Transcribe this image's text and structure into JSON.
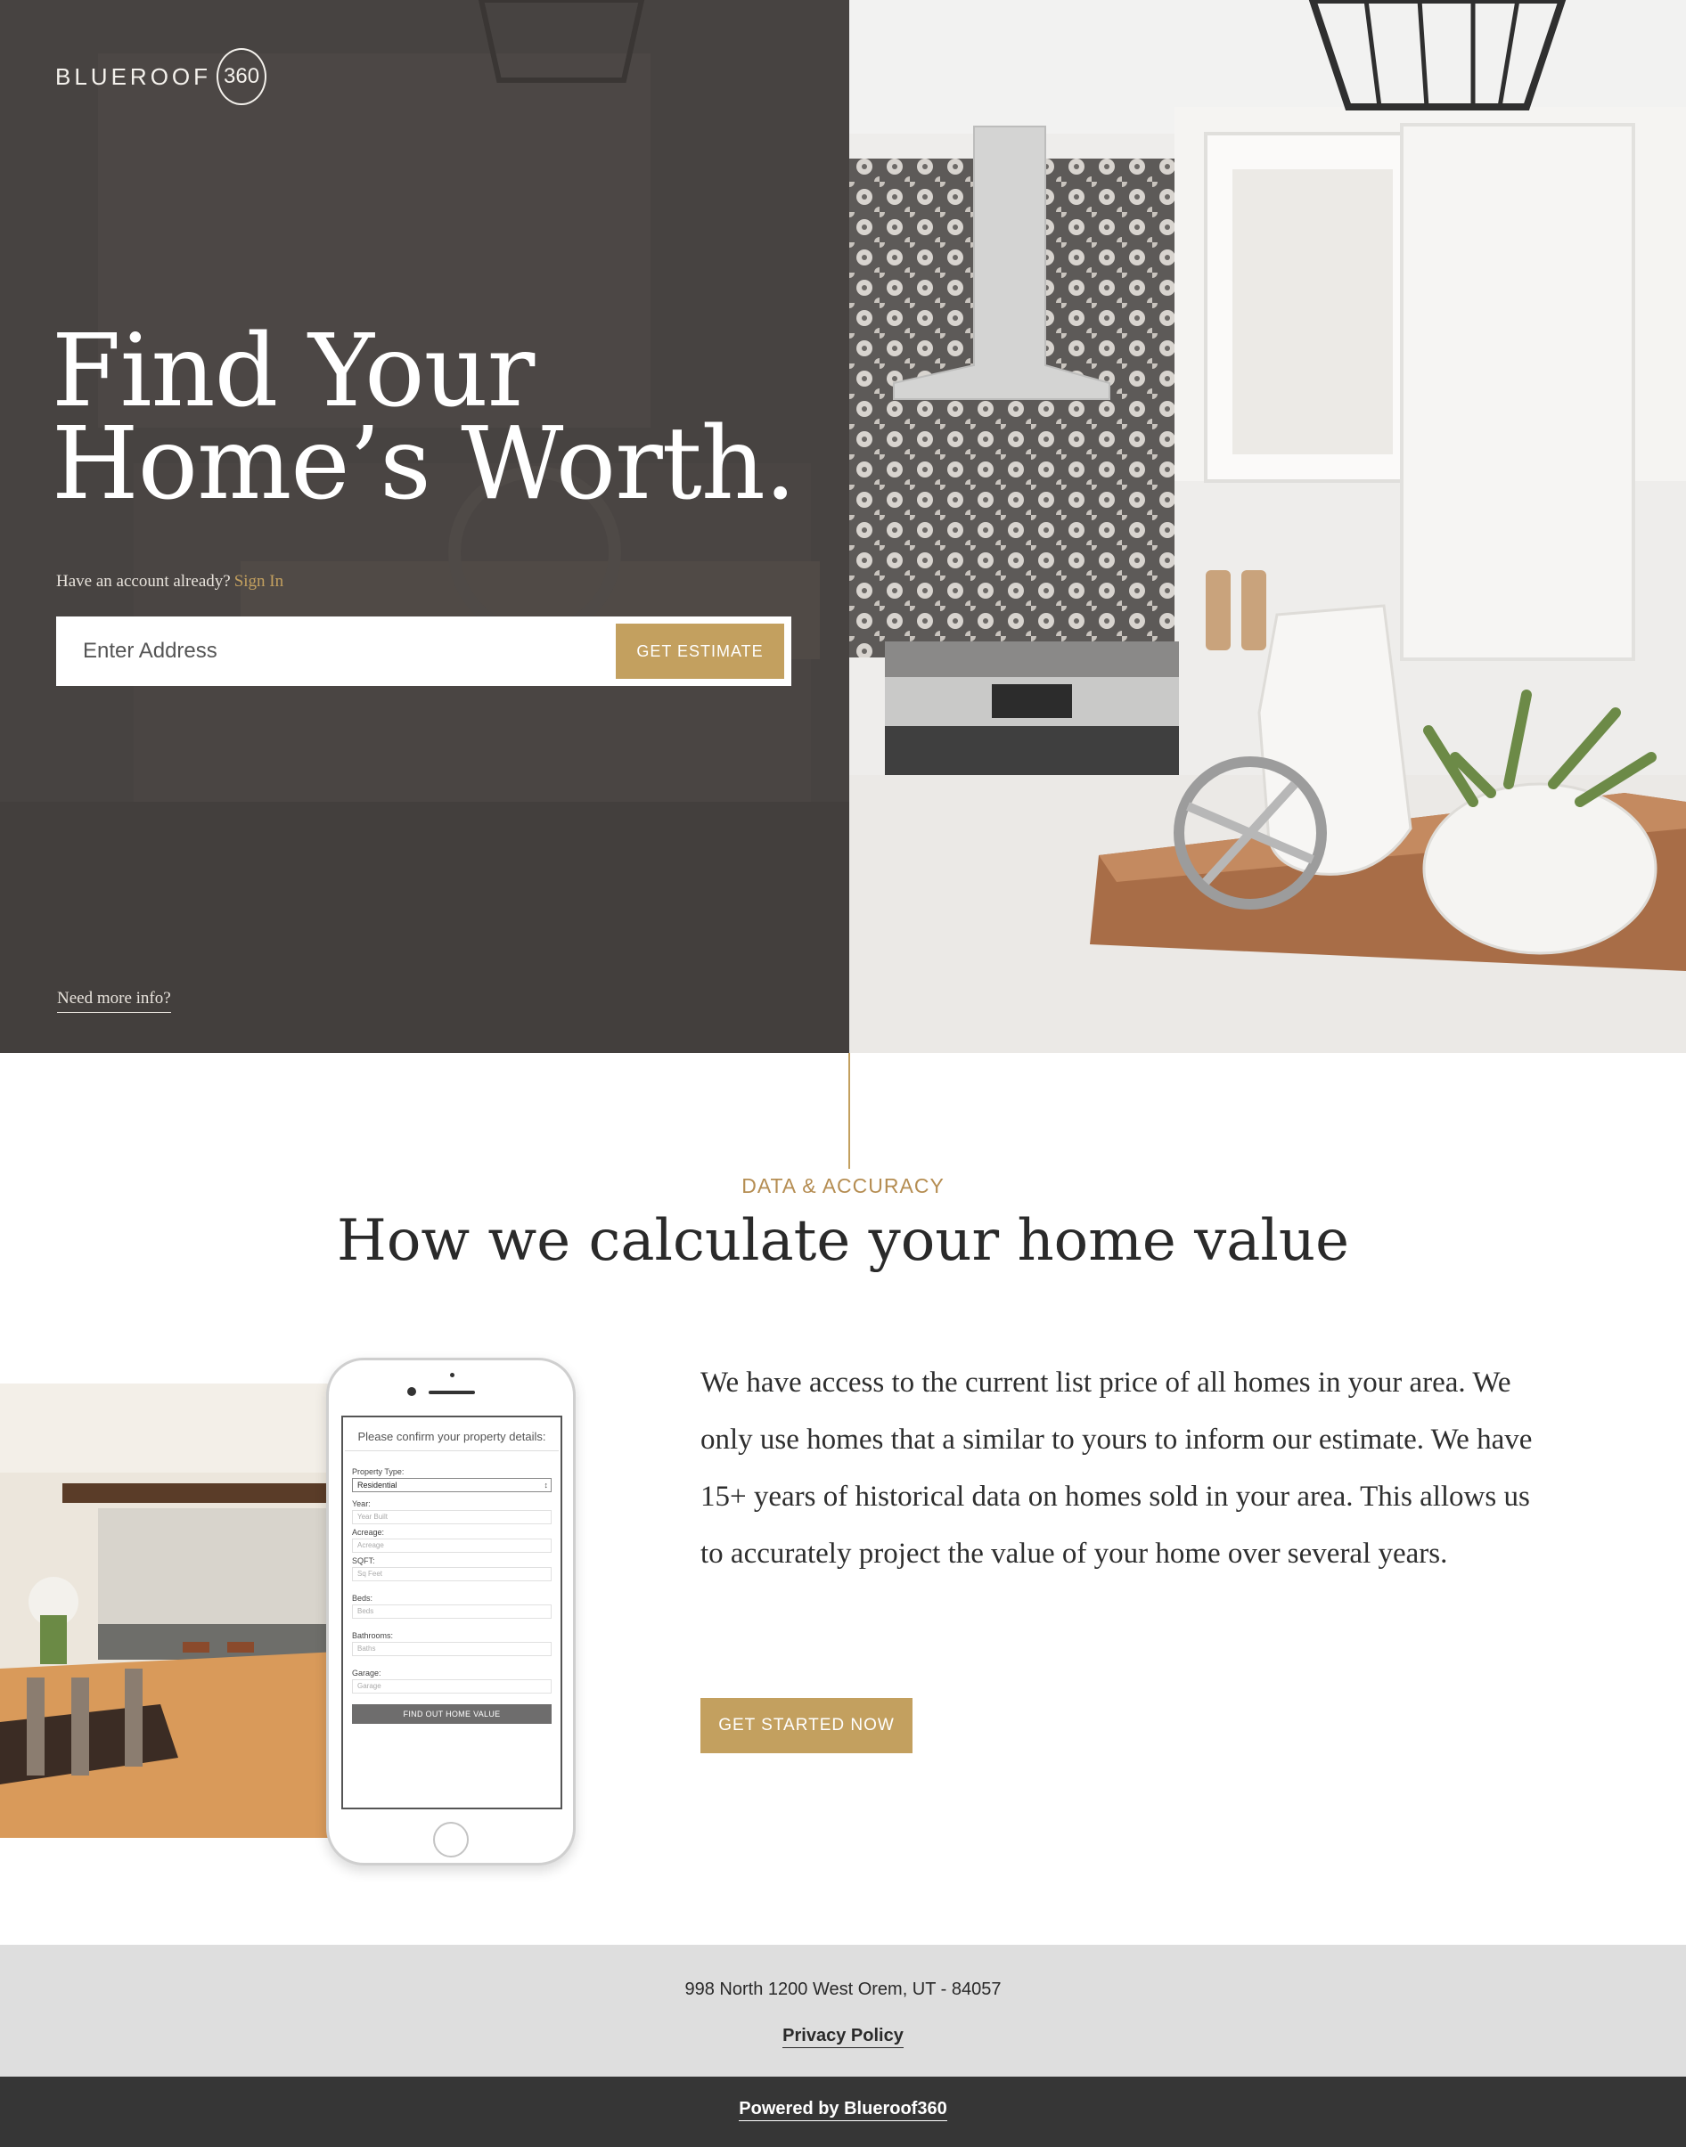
{
  "hero": {
    "logo_text": "BLUEROOF",
    "logo_badge": "360",
    "title_line1": "Find Your",
    "title_line2": "Home’s Worth.",
    "account_prompt": "Have an account already?",
    "sign_in_label": "Sign In",
    "address_placeholder": "Enter Address",
    "estimate_button": "GET ESTIMATE",
    "more_info_link": "Need more info?"
  },
  "section": {
    "eyebrow": "DATA & ACCURACY",
    "title": "How we calculate your home value",
    "body": "We have access to the current list price of all homes in your area. We only use homes that a similar to yours to inform our estimate. We have 15+ years of historical data on homes sold in your area. This allows us to accurately project the value of your home over several years.",
    "cta_button": "GET STARTED NOW"
  },
  "phone_form": {
    "title": "Please confirm your property details:",
    "property_type_label": "Property Type:",
    "property_type_value": "Residential",
    "fields": [
      {
        "label": "Year:",
        "placeholder": "Year Built"
      },
      {
        "label": "Acreage:",
        "placeholder": "Acreage"
      },
      {
        "label": "SQFT:",
        "placeholder": "Sq Feet"
      },
      {
        "label": "Beds:",
        "placeholder": "Beds"
      },
      {
        "label": "Bathrooms:",
        "placeholder": "Baths"
      },
      {
        "label": "Garage:",
        "placeholder": "Garage"
      }
    ],
    "submit_label": "FIND OUT HOME VALUE"
  },
  "footer": {
    "address": "998 North 1200 West Orem, UT - 84057",
    "privacy_link": "Privacy Policy",
    "powered_by": "Powered by Blueroof360"
  },
  "colors": {
    "accent_gold": "#c3a05f",
    "hero_overlay": "#474341",
    "footer_light": "#dedede",
    "footer_dark": "#363636"
  }
}
